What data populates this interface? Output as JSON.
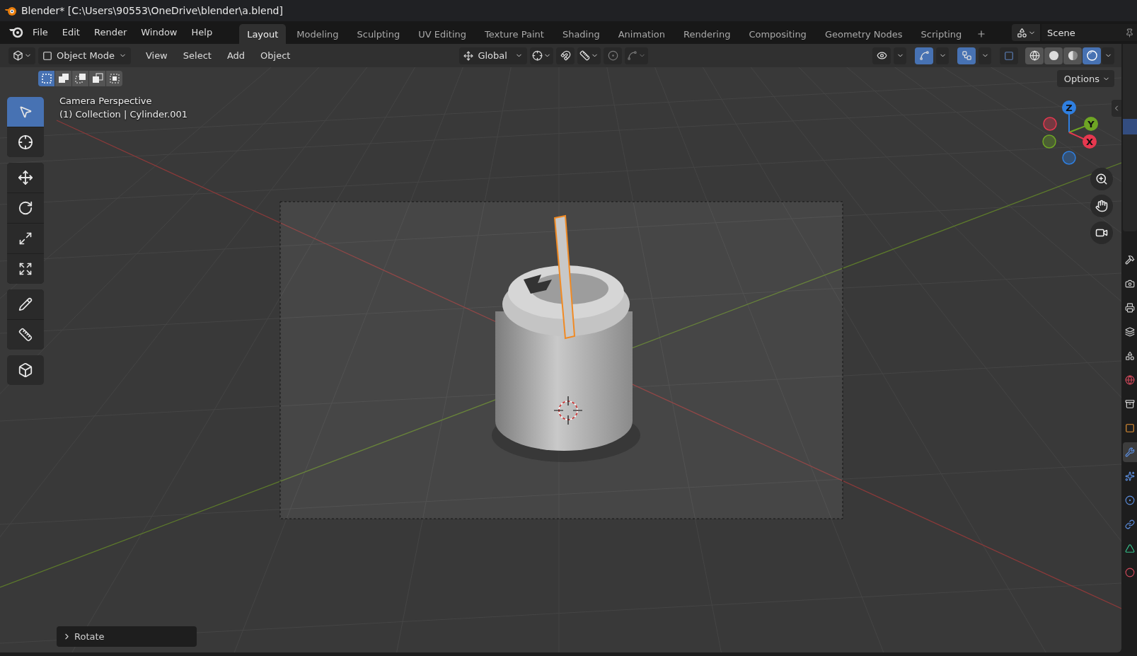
{
  "window": {
    "title": "Blender* [C:\\Users\\90553\\OneDrive\\blender\\a.blend]"
  },
  "menu": [
    "File",
    "Edit",
    "Render",
    "Window",
    "Help"
  ],
  "workspaces": [
    {
      "label": "Layout",
      "selected": true
    },
    {
      "label": "Modeling",
      "selected": false
    },
    {
      "label": "Sculpting",
      "selected": false
    },
    {
      "label": "UV Editing",
      "selected": false
    },
    {
      "label": "Texture Paint",
      "selected": false
    },
    {
      "label": "Shading",
      "selected": false
    },
    {
      "label": "Animation",
      "selected": false
    },
    {
      "label": "Rendering",
      "selected": false
    },
    {
      "label": "Compositing",
      "selected": false
    },
    {
      "label": "Geometry Nodes",
      "selected": false
    },
    {
      "label": "Scripting",
      "selected": false
    }
  ],
  "scene": {
    "value": "Scene"
  },
  "header": {
    "mode": "Object Mode",
    "menus": [
      "View",
      "Select",
      "Add",
      "Object"
    ],
    "orientation": "Global",
    "snap_on": false,
    "proportional_on": false
  },
  "viewport_toggles": [
    {
      "kind": "visibility",
      "on": false
    },
    {
      "kind": "gizmo",
      "on": true
    },
    {
      "kind": "overlay",
      "on": true
    },
    {
      "kind": "xray",
      "on": false
    }
  ],
  "shading_modes": [
    {
      "kind": "wireframe",
      "selected": false
    },
    {
      "kind": "solid",
      "selected": false
    },
    {
      "kind": "material",
      "selected": false
    },
    {
      "kind": "rendered",
      "selected": true
    }
  ],
  "select_modes": [
    {
      "kind": "new",
      "selected": true
    },
    {
      "kind": "extend",
      "selected": false
    },
    {
      "kind": "subtract",
      "selected": false
    },
    {
      "kind": "invert",
      "selected": false
    },
    {
      "kind": "intersect",
      "selected": false
    }
  ],
  "options": "Options",
  "view_info": [
    "Camera Perspective",
    "(1) Collection | Cylinder.001"
  ],
  "tool_groups": [
    {
      "tools": [
        {
          "kind": "select",
          "selected": true
        },
        {
          "kind": "cursor",
          "selected": false
        }
      ]
    },
    {
      "tools": [
        {
          "kind": "move",
          "selected": false
        },
        {
          "kind": "rotate",
          "selected": false
        },
        {
          "kind": "scale",
          "selected": false
        },
        {
          "kind": "transform",
          "selected": false
        }
      ]
    },
    {
      "tools": [
        {
          "kind": "annotate",
          "selected": false
        },
        {
          "kind": "measure",
          "selected": false
        }
      ]
    },
    {
      "tools": [
        {
          "kind": "add_cube",
          "selected": false
        }
      ]
    }
  ],
  "axes": [
    {
      "label": "Z",
      "color": "#2f7fe0"
    },
    {
      "label": "Y",
      "color": "#6ea524"
    },
    {
      "label": "X",
      "color": "#e6384f"
    }
  ],
  "last_operator": {
    "label": "Rotate",
    "expanded": false
  },
  "properties_tabs": [
    {
      "kind": "tool",
      "selected": false
    },
    {
      "kind": "render",
      "selected": false
    },
    {
      "kind": "output",
      "selected": false
    },
    {
      "kind": "view_layer",
      "selected": false
    },
    {
      "kind": "scene",
      "selected": false
    },
    {
      "kind": "world",
      "selected": false
    },
    {
      "kind": "collection",
      "selected": false
    },
    {
      "kind": "object",
      "selected": false
    },
    {
      "kind": "modifiers",
      "selected": true
    },
    {
      "kind": "particles",
      "selected": false
    },
    {
      "kind": "physics",
      "selected": false
    },
    {
      "kind": "constraints",
      "selected": false
    },
    {
      "kind": "data",
      "selected": false
    },
    {
      "kind": "material",
      "selected": false
    }
  ]
}
